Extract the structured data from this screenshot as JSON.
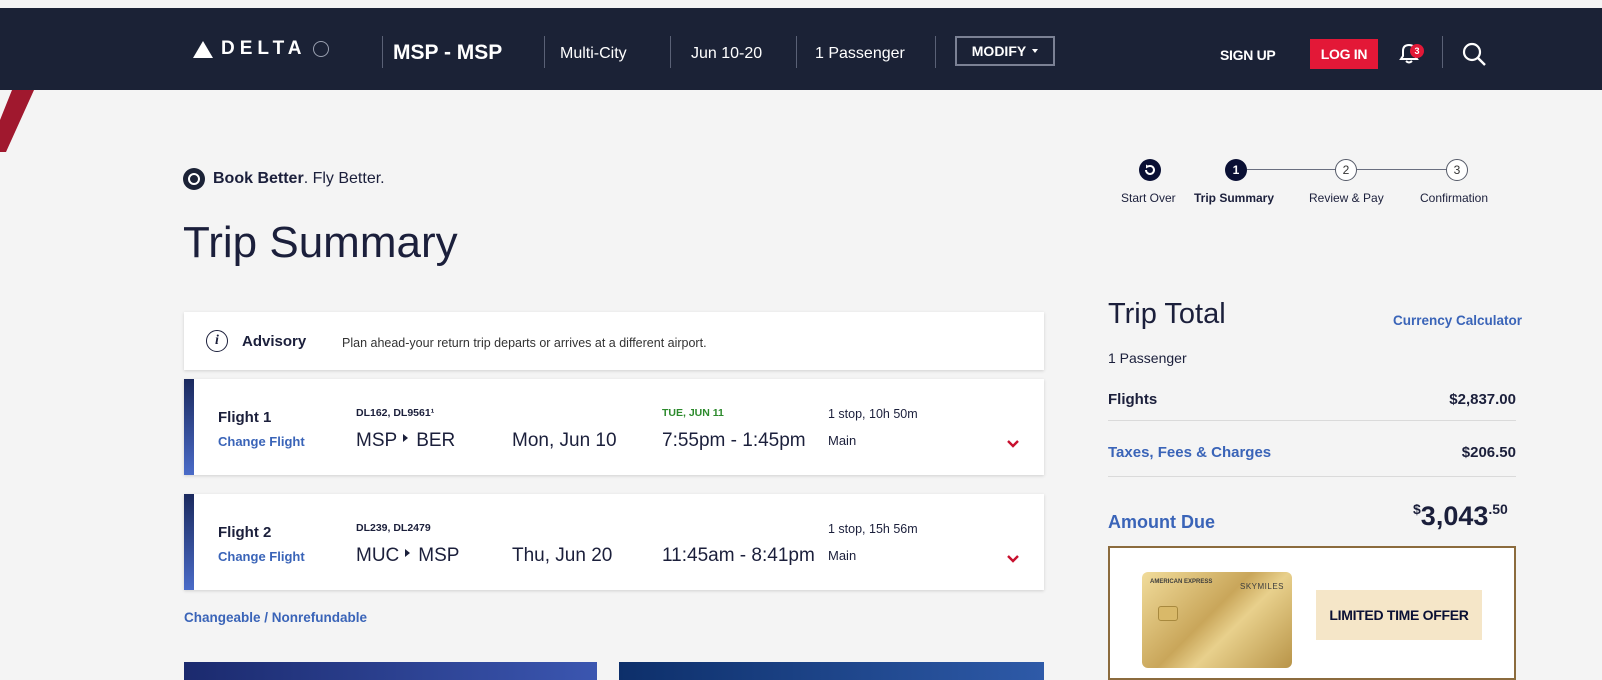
{
  "header": {
    "logo_text": "DELTA",
    "route": "MSP - MSP",
    "trip_type": "Multi-City",
    "dates": "Jun 10-20",
    "passengers": "1 Passenger",
    "modify_label": "MODIFY",
    "signup_label": "SIGN UP",
    "login_label": "LOG IN",
    "notification_count": "3"
  },
  "book_better": {
    "bold": "Book Better",
    "rest": ". Fly Better."
  },
  "page_title": "Trip Summary",
  "stepper": {
    "steps": [
      {
        "label": "Start Over",
        "number": ""
      },
      {
        "label": "Trip Summary",
        "number": "1"
      },
      {
        "label": "Review & Pay",
        "number": "2"
      },
      {
        "label": "Confirmation",
        "number": "3"
      }
    ]
  },
  "advisory": {
    "title": "Advisory",
    "text": "Plan ahead-your return trip departs or arrives at a different airport."
  },
  "flights": [
    {
      "name": "Flight 1",
      "change_label": "Change Flight",
      "flight_numbers": "DL162, DL9561¹",
      "origin": "MSP",
      "destination": "BER",
      "date": "Mon, Jun 10",
      "arrival_note": "TUE, JUN 11",
      "times": "7:55pm - 1:45pm",
      "stops": "1 stop, 10h 50m",
      "cabin": "Main"
    },
    {
      "name": "Flight 2",
      "change_label": "Change Flight",
      "flight_numbers": "DL239, DL2479",
      "origin": "MUC",
      "destination": "MSP",
      "date": "Thu, Jun 20",
      "arrival_note": "",
      "times": "11:45am - 8:41pm",
      "stops": "1 stop, 15h 56m",
      "cabin": "Main"
    }
  ],
  "fare_rules": "Changeable / Nonrefundable",
  "trip_total": {
    "title": "Trip Total",
    "currency_link": "Currency Calculator",
    "passengers": "1 Passenger",
    "flights_label": "Flights",
    "flights_amount": "$2,837.00",
    "taxes_label": "Taxes, Fees & Charges",
    "taxes_amount": "$206.50",
    "due_label": "Amount Due",
    "due_symbol": "$",
    "due_whole": "3,043",
    "due_cents": ".50"
  },
  "offer": {
    "card_brand": "AMERICAN EXPRESS",
    "card_program": "SKYMILES",
    "tag": "LIMITED TIME OFFER"
  },
  "colors": {
    "header_bg": "#1b2236",
    "login_red": "#e31837",
    "link_blue": "#3a64b8",
    "arrival_green": "#2c8a2c"
  }
}
